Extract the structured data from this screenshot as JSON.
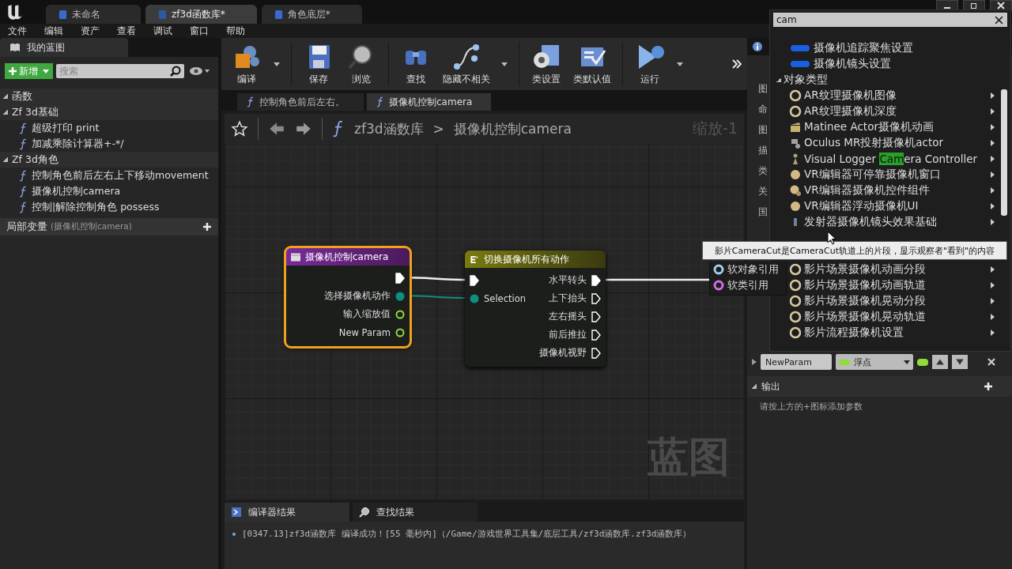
{
  "window": {
    "tabs": [
      {
        "label": "未命名",
        "selected": false
      },
      {
        "label": "zf3d函数库*",
        "selected": true
      },
      {
        "label": "角色底层*",
        "selected": false
      }
    ]
  },
  "menu": [
    "文件",
    "编辑",
    "资产",
    "查看",
    "调试",
    "窗口",
    "帮助"
  ],
  "my_blueprint": {
    "tab": "我的蓝图",
    "add_button": "新增",
    "search": {
      "placeholder": "搜索"
    },
    "tree": [
      {
        "label": "函数",
        "expanded": true,
        "children": [
          {
            "label": "Zf 3d基础",
            "expanded": true,
            "children": [
              {
                "label": "超级打印 print"
              },
              {
                "label": "加减乘除计算器+-*/"
              }
            ]
          },
          {
            "label": "Zf 3d角色",
            "expanded": true,
            "children": [
              {
                "label": "控制角色前后左右上下移动movement"
              },
              {
                "label": "摄像机控制camera"
              },
              {
                "label": "控制|解除控制角色 possess"
              }
            ]
          }
        ]
      }
    ],
    "local_vars": {
      "label": "局部变量",
      "context": "(摄像机控制camera)"
    }
  },
  "toolbar": [
    {
      "label": "编译",
      "kind": "compile"
    },
    {
      "label": "保存",
      "kind": "save"
    },
    {
      "label": "浏览",
      "kind": "browse"
    },
    {
      "label": "查找",
      "kind": "find"
    },
    {
      "label": "隐藏不相关",
      "kind": "hide"
    },
    {
      "label": "类设置",
      "kind": "settings"
    },
    {
      "label": "类默认值",
      "kind": "defaults"
    },
    {
      "label": "运行",
      "kind": "run"
    }
  ],
  "doc_tabs": [
    {
      "label": "控制角色前后左右。",
      "selected": false
    },
    {
      "label": "摄像机控制camera",
      "selected": true
    }
  ],
  "breadcrumb": {
    "library": "zf3d涵数库",
    "separator": ">",
    "function": "摄像机控制camera",
    "zoom": "缩放-1"
  },
  "graph": {
    "watermark": "蓝图",
    "nodes": [
      {
        "title": "摄像机控制camera",
        "kind": "entry",
        "selected": true,
        "outputs": [
          {
            "kind": "exec",
            "connected": true
          },
          {
            "label": "选择摄像机动作",
            "kind": "enum",
            "connected": true
          },
          {
            "label": "输入缩放值",
            "kind": "float",
            "connected": false
          },
          {
            "label": "New Param",
            "kind": "float",
            "connected": false
          }
        ]
      },
      {
        "title": "切换摄像机所有动作",
        "kind": "switch",
        "selected": false,
        "inputs": [
          {
            "kind": "exec",
            "connected": true
          },
          {
            "label": "Selection",
            "kind": "enum",
            "connected": true
          }
        ],
        "outputs": [
          {
            "label": "水平转头",
            "kind": "exec",
            "connected": true
          },
          {
            "label": "上下抬头",
            "kind": "exec",
            "connected": false
          },
          {
            "label": "左右摇头",
            "kind": "exec",
            "connected": false
          },
          {
            "label": "前后推拉",
            "kind": "exec",
            "connected": false
          },
          {
            "label": "摄像机视野",
            "kind": "exec",
            "connected": false
          }
        ]
      }
    ]
  },
  "bottom": {
    "tabs": [
      {
        "label": "编译器结果",
        "selected": true
      },
      {
        "label": "查找结果",
        "selected": false
      }
    ],
    "log": [
      "[0347.13]zf3d涵数库 编译成功！[55 毫秒内]（/Game/游戏世界工具集/底层工具/zf3d涵数库.zf3d涵数库）"
    ]
  },
  "details": {
    "fragments": [
      "图",
      "命",
      "图",
      "描",
      "类",
      "关",
      "国"
    ],
    "param": {
      "name": "NewParam",
      "type": "浮点"
    },
    "outputs_header": "输出",
    "hint": "请按上方的+图标添加参数"
  },
  "pin_type_menu": [
    {
      "label": "软对象引用",
      "color": "#9fd0f0"
    },
    {
      "label": "软类引用",
      "color": "#d070e0"
    }
  ],
  "type_picker": {
    "search": "cam",
    "structs": [
      {
        "label": "摄像机追踪聚焦设置"
      },
      {
        "label": "摄像机镜头设置"
      }
    ],
    "category": {
      "label": "对象类型",
      "expanded": true,
      "items": [
        {
          "label": "AR纹理摄像机图像",
          "kind": "ring"
        },
        {
          "label": "AR纹理摄像机深度",
          "kind": "ring"
        },
        {
          "label": "Matinee Actor摄像机动画",
          "kind": "clapper"
        },
        {
          "label": "Oculus MR投射摄像机actor",
          "kind": "robot"
        },
        {
          "label_before": "Visual Logger ",
          "label_match": "Cam",
          "label_after": "era Controller",
          "kind": "figure"
        },
        {
          "label": "VR编辑器可停靠摄像机窗口",
          "kind": "ball"
        },
        {
          "label": "VR编辑器摄像机控件组件",
          "kind": "balls"
        },
        {
          "label": "VR编辑器浮动摄像机UI",
          "kind": "ball"
        },
        {
          "label": "发射器摄像机镜头效果基础",
          "kind": "emitter"
        },
        {
          "label": "影片场景摄像机动画分段",
          "kind": "ring"
        },
        {
          "label": "影片场景摄像机动画轨道",
          "kind": "ring"
        },
        {
          "label": "影片场景摄像机晃动分段",
          "kind": "ring"
        },
        {
          "label": "影片场景摄像机晃动轨道",
          "kind": "ring"
        },
        {
          "label": "影片流程摄像机设置",
          "kind": "ring"
        }
      ]
    }
  },
  "tooltip": "影片CameraCut是CameraCut轨道上的片段，显示观察者\"看到\"的内容"
}
